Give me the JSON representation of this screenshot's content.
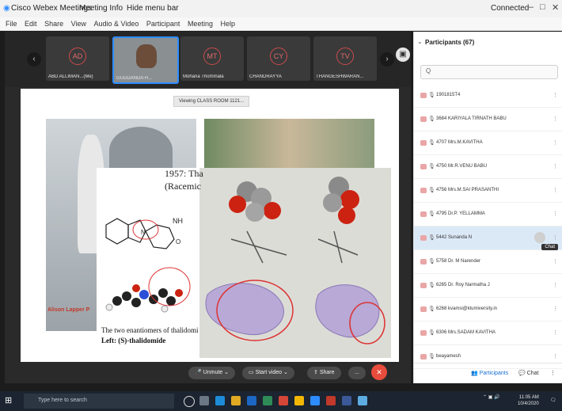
{
  "window": {
    "title_items": [
      "Cisco Webex Meetings",
      "Meeting Info",
      "Hide menu bar"
    ],
    "connected": "Connected",
    "menu": [
      "File",
      "Edit",
      "Share",
      "View",
      "Audio & Video",
      "Participant",
      "Meeting",
      "Help"
    ]
  },
  "thumbnails": [
    {
      "initials": "AD",
      "name": "ABD ALLIMAN...(Me)"
    },
    {
      "initials": "",
      "name": "GUDDANDA H..."
    },
    {
      "initials": "MT",
      "name": "Mohana Thommala"
    },
    {
      "initials": "CY",
      "name": "CHANDRAYYA"
    },
    {
      "initials": "TV",
      "name": "THANGESHWARAN..."
    }
  ],
  "slide": {
    "viewing": "Viewing CLASS ROOM 1121...",
    "year_text": "1957: Tha",
    "racemic_text": "(Racemic",
    "caption_line1": "The two enantiomers of thalidomi",
    "caption_line2": "Left: (S)-thalidomide",
    "photo_credit": "Alison Lapper P"
  },
  "participants": {
    "header": "Participants (67)",
    "search_placeholder": "Q",
    "rows": [
      {
        "name": "1901815T4",
        "highlight": false
      },
      {
        "name": "3684 KARIYALA TIRNATH BABU",
        "highlight": false
      },
      {
        "name": "4707 Mrs.M.KAVITHA",
        "highlight": false
      },
      {
        "name": "4750 Mr.R.VENU BABU",
        "highlight": false
      },
      {
        "name": "4756 Mrs.M.SAI PRASANTHI",
        "highlight": false
      },
      {
        "name": "4795 Dr.P. YELLAMMA",
        "highlight": false
      },
      {
        "name": "5442 Sunanda N",
        "highlight": true
      },
      {
        "name": "5758 Dr. M Narender",
        "highlight": false
      },
      {
        "name": "6265 Dr. Roy Narmatha J",
        "highlight": false
      },
      {
        "name": "6268 kvamsi@klumiversity.in",
        "highlight": false
      },
      {
        "name": "6306 Mrs.SADAM KAVITHA",
        "highlight": false
      },
      {
        "name": "beayamesh",
        "highlight": false
      }
    ],
    "chat_tooltip": "Chat",
    "footer_participants": "Participants",
    "footer_chat": "Chat"
  },
  "controls": {
    "unmute": "Unmute",
    "start_video": "Start video",
    "share": "Share",
    "more": "...",
    "end": "✕"
  },
  "taskbar": {
    "search_placeholder": "Type here to search",
    "time": "11:05 AM",
    "date": "10/4/2020"
  },
  "colors": {
    "accent": "#2d8cff",
    "end_call": "#e74c3c",
    "highlight_row": "#dbe9f7"
  }
}
